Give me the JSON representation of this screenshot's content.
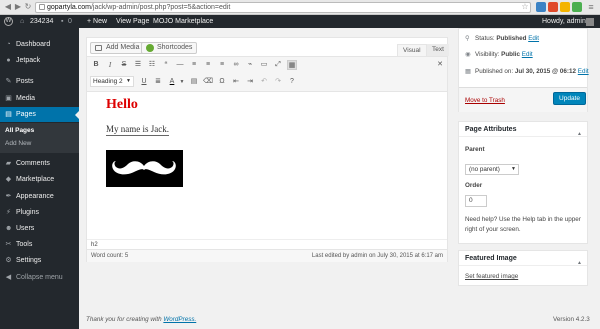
{
  "browser": {
    "host": "gopartyla.com",
    "path": "/jack/wp-admin/post.php?post=5&action=edit"
  },
  "adminbar": {
    "site_name": "234234",
    "comments_count": "0",
    "new_label": "+ New",
    "view_page_label": "View Page",
    "mojo_label": "MOJO Marketplace",
    "howdy_label": "Howdy, admin"
  },
  "sidebar": {
    "items": [
      {
        "label": "Dashboard",
        "icon": "dashboard-icon"
      },
      {
        "label": "Jetpack",
        "icon": "jetpack-icon"
      },
      {
        "label": "Posts",
        "icon": "pin-icon"
      },
      {
        "label": "Media",
        "icon": "media-icon"
      },
      {
        "label": "Pages",
        "icon": "pages-icon"
      },
      {
        "label": "Comments",
        "icon": "comments-icon"
      },
      {
        "label": "Marketplace",
        "icon": "marketplace-icon"
      },
      {
        "label": "Appearance",
        "icon": "appearance-icon"
      },
      {
        "label": "Plugins",
        "icon": "plugins-icon"
      },
      {
        "label": "Users",
        "icon": "users-icon"
      },
      {
        "label": "Tools",
        "icon": "tools-icon"
      },
      {
        "label": "Settings",
        "icon": "settings-icon"
      },
      {
        "label": "Collapse menu",
        "icon": "collapse-icon"
      }
    ],
    "submenu": [
      "All Pages",
      "Add New"
    ]
  },
  "editor": {
    "add_media_label": "Add Media",
    "shortcodes_label": "Shortcodes",
    "tab_visual": "Visual",
    "tab_text": "Text",
    "format_select": "Heading 2",
    "content_heading": "Hello",
    "content_paragraph": "My name is Jack.",
    "path": "h2",
    "word_count": "Word count: 5",
    "last_edited": "Last edited by admin on July 30, 2015 at 6:17 am"
  },
  "publish": {
    "status_label": "Status:",
    "status_value": "Published",
    "visibility_label": "Visibility:",
    "visibility_value": "Public",
    "published_label": "Published on:",
    "published_value": "Jul 30, 2015 @ 06:12",
    "edit_label": "Edit",
    "trash_label": "Move to Trash",
    "update_label": "Update"
  },
  "page_attributes": {
    "title": "Page Attributes",
    "parent_label": "Parent",
    "parent_value": "(no parent)",
    "order_label": "Order",
    "order_value": "0",
    "help_line1": "Need help? Use the Help tab in the upper",
    "help_line2": "right of your screen."
  },
  "featured_image": {
    "title": "Featured Image",
    "link": "Set featured image"
  },
  "footer": {
    "thanks_prefix": "Thank you for creating with ",
    "thanks_link": "WordPress.",
    "version": "Version 4.2.3"
  },
  "colors": {
    "admin_bg": "#23282d",
    "accent": "#0073aa",
    "trash": "#a00",
    "heading_red": "#dd0000"
  }
}
